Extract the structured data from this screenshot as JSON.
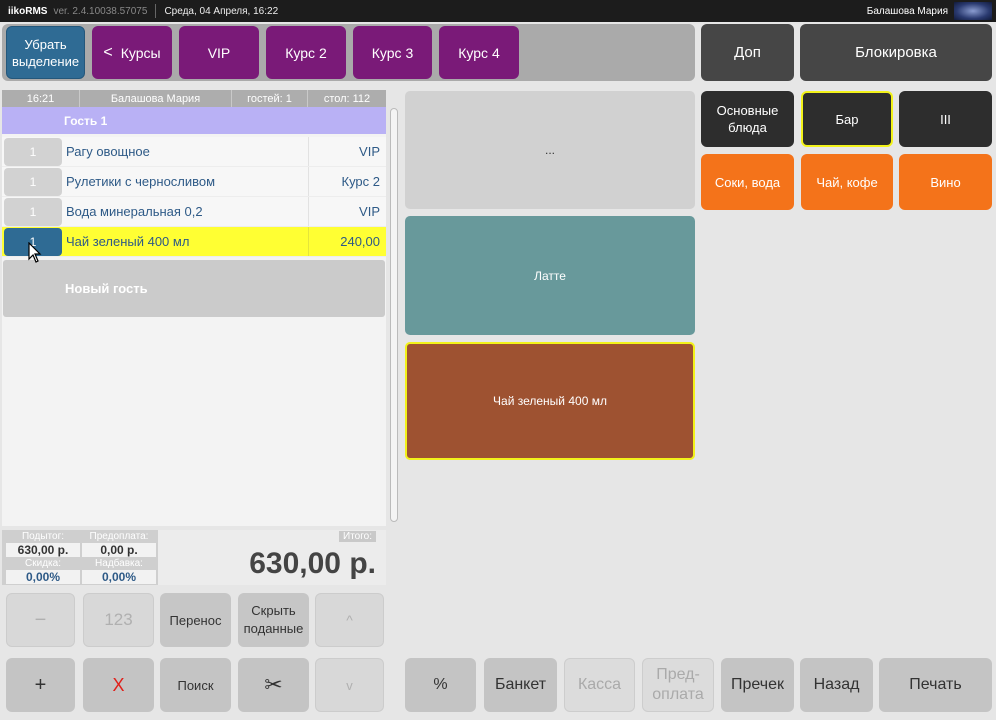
{
  "titlebar": {
    "app": "iikoRMS",
    "version": "ver. 2.4.10038.57075",
    "date": "Среда, 04 Апреля, 16:22",
    "user": "Балашова Мария"
  },
  "topbar": {
    "deselect": "Убрать выделение",
    "courses": "Курсы",
    "vip": "VIP",
    "course2": "Курс 2",
    "course3": "Курс 3",
    "course4": "Курс 4",
    "extra": "Доп",
    "lock": "Блокировка"
  },
  "order": {
    "time": "16:21",
    "waiter": "Балашова Мария",
    "guests": "гостей: 1",
    "table": "стол: 112",
    "guest_label": "Гость 1",
    "items": [
      {
        "qty": "1",
        "name": "Рагу овощное",
        "course": "VIP"
      },
      {
        "qty": "1",
        "name": "Рулетики с черносливом",
        "course": "Курс 2"
      },
      {
        "qty": "1",
        "name": "Вода минеральная 0,2",
        "course": "VIP"
      },
      {
        "qty": "1",
        "name": "Чай зеленый 400 мл",
        "course": "240,00"
      }
    ],
    "new_guest": "Новый гость"
  },
  "totals": {
    "subtotal_label": "Подытог:",
    "subtotal": "630,00 р.",
    "prepay_label": "Предоплата:",
    "prepay": "0,00 р.",
    "discount_label": "Скидка:",
    "discount": "0,00%",
    "surcharge_label": "Надбавка:",
    "surcharge": "0,00%",
    "total_label": "Итого:",
    "total": "630,00 р."
  },
  "keypad": {
    "minus": "−",
    "num": "123",
    "transfer": "Перенос",
    "hide_served": "Скрыть поданные",
    "up": "^",
    "plus": "+",
    "delete": "X",
    "search": "Поиск",
    "scissors": "✂",
    "down": "v"
  },
  "dishes": {
    "ellipsis": "...",
    "latte": "Латте",
    "green_tea": "Чай зеленый 400 мл"
  },
  "categories": {
    "main": "Основные блюда",
    "bar": "Бар",
    "iii": "III",
    "juices": "Соки, вода",
    "tea": "Чай, кофе",
    "wine": "Вино"
  },
  "bottom": {
    "percent": "%",
    "banquet": "Банкет",
    "cash": "Касса",
    "prepay": "Пред-оплата",
    "precheck": "Пречек",
    "back": "Назад",
    "print": "Печать"
  },
  "colors": {
    "accent_blue": "#2f6b94",
    "course_purple": "#7a1a78",
    "category_orange": "#f4731a",
    "selection_yellow": "#ffff33",
    "latte_teal": "#68999b",
    "tea_brown": "#9e5231"
  }
}
